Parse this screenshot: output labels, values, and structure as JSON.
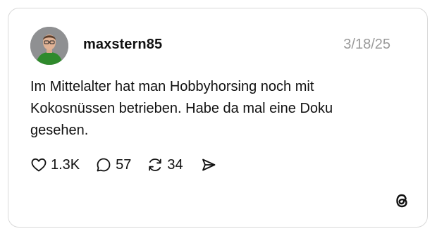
{
  "post": {
    "username": "maxstern85",
    "date": "3/18/25",
    "text": "Im Mittelalter hat man Hobbyhorsing noch mit Kokosnüssen betrieben. Habe da mal eine Doku gesehen."
  },
  "actions": {
    "likes": "1.3K",
    "replies": "57",
    "reposts": "34"
  },
  "icons": {
    "like": "heart-icon",
    "reply": "speech-bubble-icon",
    "repost": "repost-arrows-icon",
    "share": "send-icon",
    "brand": "threads-logo-icon"
  },
  "colors": {
    "text": "#111111",
    "muted": "#9a9a9a",
    "border": "#d9d9d9",
    "avatar_shirt": "#2f8a2c"
  }
}
